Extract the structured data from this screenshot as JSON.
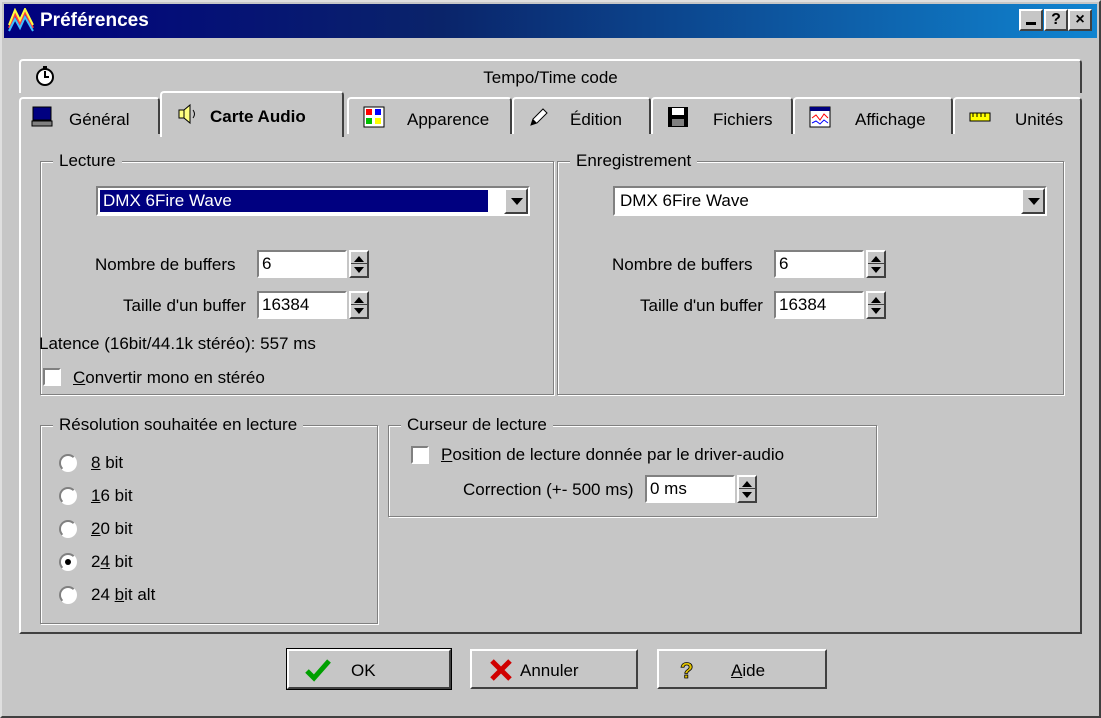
{
  "window": {
    "title": "Préférences",
    "buttons": [
      "_",
      "?",
      "×"
    ]
  },
  "tabs_row1": {
    "label": "Tempo/Time code",
    "icon": "clock-icon"
  },
  "tabs": [
    {
      "label": "Général",
      "icon": "monitor-icon"
    },
    {
      "label": "Carte Audio",
      "icon": "speaker-icon",
      "active": true
    },
    {
      "label": "Apparence",
      "icon": "palette-icon"
    },
    {
      "label": "Édition",
      "icon": "pencil-icon"
    },
    {
      "label": "Fichiers",
      "icon": "floppy-icon"
    },
    {
      "label": "Affichage",
      "icon": "display-icon"
    },
    {
      "label": "Unités",
      "icon": "ruler-icon"
    }
  ],
  "lecture": {
    "title": "Lecture",
    "device": "DMX 6Fire Wave",
    "buffers_label": "Nombre de buffers",
    "buffers_value": "6",
    "size_label": "Taille d'un buffer",
    "size_value": "16384",
    "latency": "Latence (16bit/44.1k stéréo): 557 ms",
    "mono_pre": "",
    "mono_ul": "C",
    "mono_post": "onvertir mono en stéréo",
    "mono_checked": false
  },
  "enregistrement": {
    "title": "Enregistrement",
    "device": "DMX 6Fire Wave",
    "buffers_label": "Nombre de buffers",
    "buffers_value": "6",
    "size_label": "Taille d'un buffer",
    "size_value": "16384"
  },
  "resolution": {
    "title": "Résolution souhaitée en lecture",
    "options": [
      {
        "pre": "",
        "ul": "8",
        "post": " bit",
        "checked": false
      },
      {
        "pre": "",
        "ul": "1",
        "post": "6 bit",
        "checked": false
      },
      {
        "pre": "",
        "ul": "2",
        "post": "0 bit",
        "checked": false
      },
      {
        "pre": "2",
        "ul": "4",
        "post": " bit",
        "checked": true
      },
      {
        "pre": "24 ",
        "ul": "b",
        "post": "it alt",
        "checked": false
      }
    ]
  },
  "curseur": {
    "title": "Curseur de lecture",
    "pos_ul": "P",
    "pos_post": "osition de lecture donnée par le driver-audio",
    "pos_checked": false,
    "correction_label": "Correction (+- 500 ms)",
    "correction_value": "0 ms"
  },
  "buttons": {
    "ok": "OK",
    "annuler": "Annuler",
    "aide_ul": "A",
    "aide_post": "ide"
  }
}
